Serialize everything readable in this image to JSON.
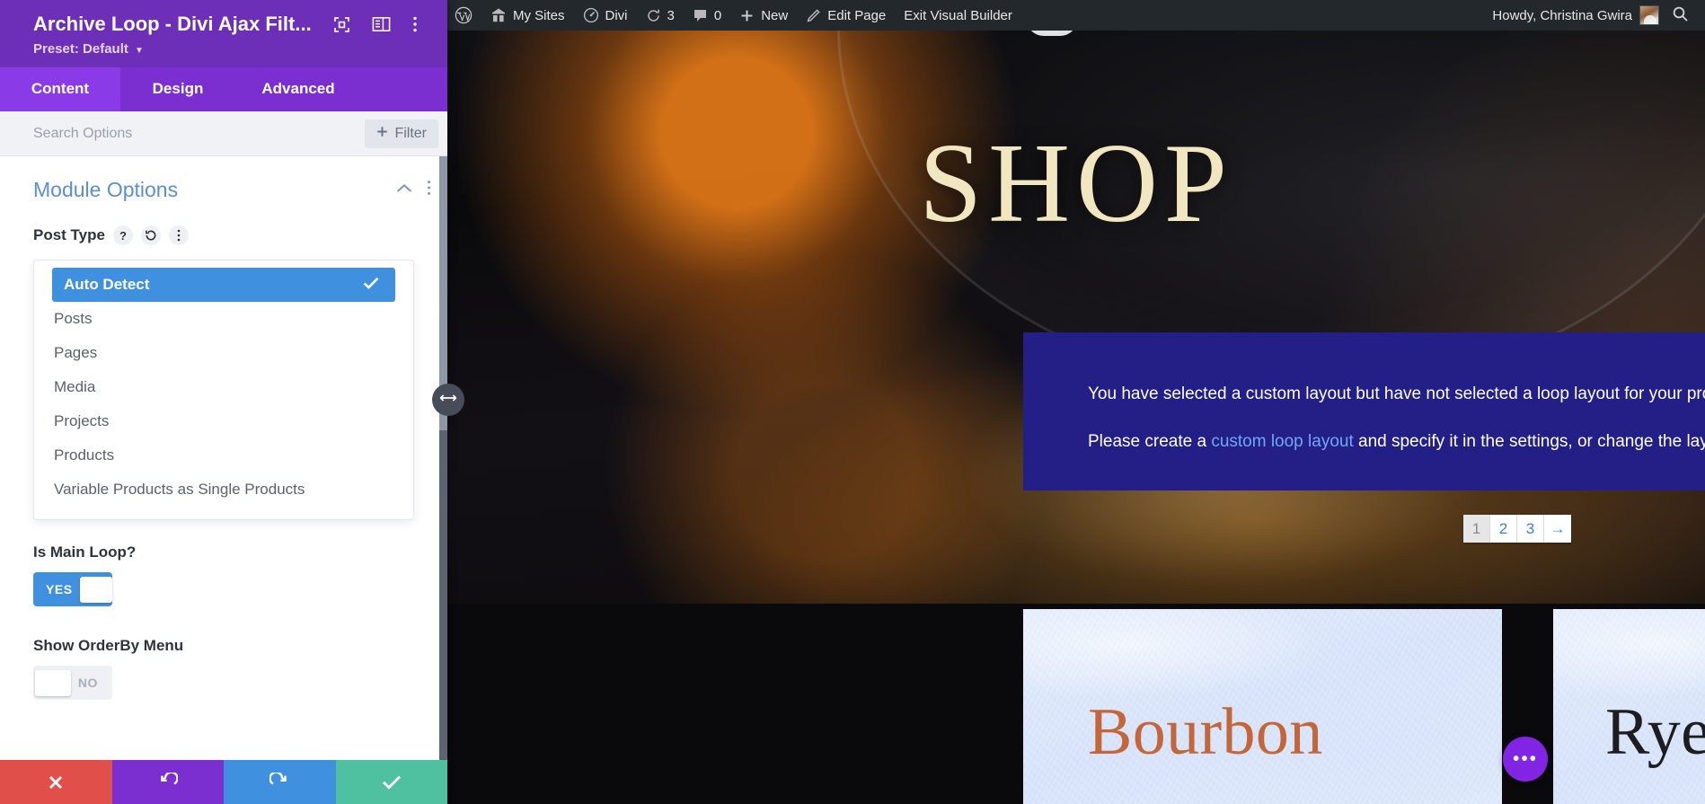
{
  "adminbar": {
    "items": [
      {
        "icon": "wordpress-logo-icon",
        "label": ""
      },
      {
        "icon": "my-sites-icon",
        "label": "My Sites"
      },
      {
        "icon": "divi-icon",
        "label": "Divi"
      },
      {
        "icon": "updates-icon",
        "label": "3"
      },
      {
        "icon": "comments-icon",
        "label": "0"
      },
      {
        "icon": "plus-icon",
        "label": "New"
      },
      {
        "icon": "pencil-icon",
        "label": "Edit Page"
      },
      {
        "icon": "",
        "label": "Exit Visual Builder"
      }
    ],
    "howdy": "Howdy, Christina Gwira",
    "search_icon": "search-icon",
    "bg_color": "#23282d"
  },
  "panel": {
    "title": "Archive Loop - Divi Ajax Filt...",
    "preset_label": "Preset: Default",
    "header_icons": [
      "target-focus-icon",
      "layout-columns-icon",
      "kebab-menu-icon"
    ],
    "tabs": [
      {
        "label": "Content",
        "active": true
      },
      {
        "label": "Design",
        "active": false
      },
      {
        "label": "Advanced",
        "active": false
      }
    ],
    "search": {
      "placeholder": "Search Options",
      "value": ""
    },
    "filter_button": {
      "label": "Filter",
      "icon": "plus-icon"
    },
    "section": {
      "title": "Module Options",
      "collapse_icon": "chevron-up-icon",
      "menu_icon": "kebab-menu-icon"
    },
    "fields": {
      "post_type": {
        "label": "Post Type",
        "help_icon": "question-mark-icon",
        "reset_icon": "reset-undo-icon",
        "more_icon": "kebab-menu-icon",
        "selected": "Auto Detect",
        "options": [
          "Auto Detect",
          "Posts",
          "Pages",
          "Media",
          "Projects",
          "Products",
          "Variable Products as Single Products"
        ]
      },
      "is_main_loop": {
        "label": "Is Main Loop?",
        "state": "YES",
        "on": true
      },
      "show_orderby_menu": {
        "label": "Show OrderBy Menu",
        "state": "NO",
        "on": false
      }
    },
    "footer_buttons": [
      {
        "name": "cancel",
        "icon": "close-x-icon",
        "color": "#e04f49"
      },
      {
        "name": "undo",
        "icon": "undo-arrow-icon",
        "color": "#7b2fd0"
      },
      {
        "name": "redo",
        "icon": "redo-arrow-icon",
        "color": "#3f91e0"
      },
      {
        "name": "save",
        "icon": "checkmark-icon",
        "color": "#4fc0a0"
      }
    ],
    "resize_handle_icon": "horizontal-resize-icon",
    "colors": {
      "header": "#6d2eb8",
      "tabs": "#7b2fd0",
      "tab_active": "#8a3ae6",
      "accent": "#3f91e0"
    }
  },
  "canvas": {
    "hero_title": "SHOP",
    "notice": {
      "line1": "You have selected a custom layout but have not selected a loop layout for your products",
      "line2_before": "Please create a ",
      "line2_link": "custom loop layout",
      "line2_after": " and specify it in the settings, or change the layout style to be default.",
      "bg_color": "#241f86",
      "link_color": "#6fa8f5"
    },
    "pagination": {
      "pages": [
        "1",
        "2",
        "3"
      ],
      "current": "1",
      "next_label": "→"
    },
    "products": [
      {
        "title": "Bourbon",
        "title_color": "#c3673a"
      },
      {
        "title": "Rye",
        "title_color": "#1d1d20"
      }
    ],
    "floating_button": {
      "icon": "ellipsis-icon",
      "label": "•••",
      "color": "#8224e3"
    }
  }
}
